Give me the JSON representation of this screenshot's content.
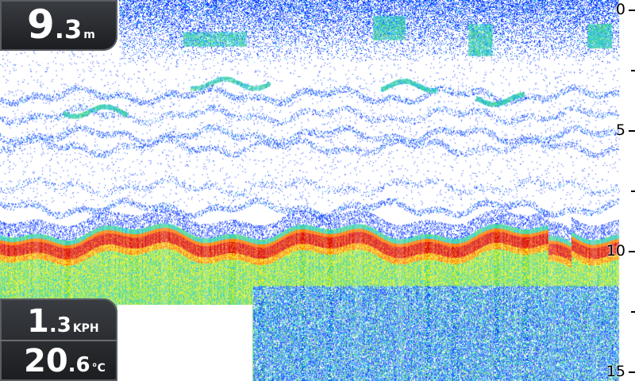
{
  "depth": {
    "value_int": "9",
    "value_dec": ".3",
    "unit": "m",
    "icon": "depth-readout"
  },
  "speed": {
    "value_int": "1",
    "value_dec": ".3",
    "unit": "KPH"
  },
  "temperature": {
    "value_int": "20",
    "value_dec": ".6",
    "unit": "°C"
  },
  "depth_scale": {
    "min": 0,
    "max": 15,
    "labels": [
      "0",
      "5",
      "10",
      "15"
    ],
    "label_values": [
      0,
      5,
      10,
      15
    ],
    "minor_ticks": [
      2.5,
      7.5,
      12.5
    ]
  },
  "sonar": {
    "bottom_depth_m": 9.3,
    "colors": {
      "strong": "#d81010",
      "orange": "#ff7a00",
      "yellow": "#f0f020",
      "green": "#60e060",
      "cyan": "#20c0f0",
      "blue": "#1040ff",
      "background": "#ffffff"
    }
  }
}
